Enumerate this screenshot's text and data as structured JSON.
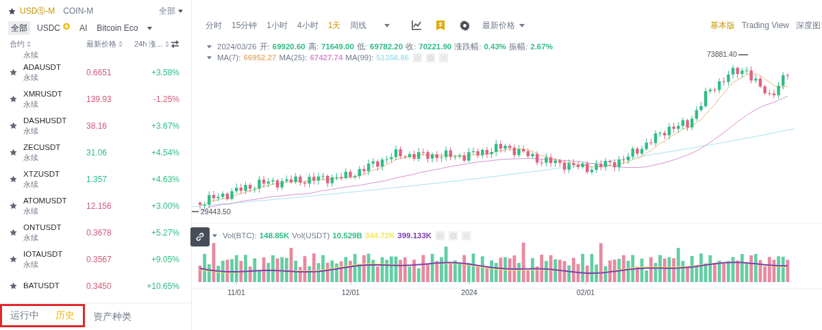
{
  "market_tabs": [
    {
      "label": "USDⓈ-M",
      "selected": true
    },
    {
      "label": "COIN-M",
      "selected": false
    }
  ],
  "filter_menu": "全部",
  "categories": [
    {
      "label": "全部",
      "selected": true,
      "kind": "text"
    },
    {
      "label": "USDC",
      "selected": false,
      "kind": "badge"
    },
    {
      "label": "AI",
      "selected": false,
      "kind": "text"
    },
    {
      "label": "Bitcoin Eco",
      "selected": false,
      "kind": "text"
    }
  ],
  "columns": [
    "合约",
    "最新价格",
    "24h 涨..."
  ],
  "partial_row": {
    "type": "永续"
  },
  "rows": [
    {
      "symbol": "ADAUSDT",
      "type": "永续",
      "price": "0.6651",
      "price_up": false,
      "change": "+3.58%",
      "change_up": true
    },
    {
      "symbol": "XMRUSDT",
      "type": "永续",
      "price": "139.93",
      "price_up": false,
      "change": "-1.25%",
      "change_up": false
    },
    {
      "symbol": "DASHUSDT",
      "type": "永续",
      "price": "38.16",
      "price_up": false,
      "change": "+3.67%",
      "change_up": true
    },
    {
      "symbol": "ZECUSDT",
      "type": "永续",
      "price": "31.06",
      "price_up": true,
      "change": "+4.54%",
      "change_up": true
    },
    {
      "symbol": "XTZUSDT",
      "type": "永续",
      "price": "1.357",
      "price_up": true,
      "change": "+4.63%",
      "change_up": true
    },
    {
      "symbol": "ATOMUSDT",
      "type": "永续",
      "price": "12.156",
      "price_up": false,
      "change": "+3.00%",
      "change_up": true
    },
    {
      "symbol": "ONTUSDT",
      "type": "永续",
      "price": "0.3678",
      "price_up": false,
      "change": "+5.27%",
      "change_up": true
    },
    {
      "symbol": "IOTAUSDT",
      "type": "永续",
      "price": "0.3567",
      "price_up": false,
      "change": "+9.05%",
      "change_up": true
    },
    {
      "symbol": "BATUSDT",
      "price": "0.3450",
      "price_up": false,
      "change": "+10.65%",
      "change_up": true
    }
  ],
  "bottom_tabs": [
    {
      "label": "运行中",
      "selected": false
    },
    {
      "label": "历史",
      "selected": true
    },
    {
      "label": "资产种类",
      "selected": false
    }
  ],
  "intervals": [
    {
      "label": "分时",
      "selected": false
    },
    {
      "label": "15分钟",
      "selected": false
    },
    {
      "label": "1小时",
      "selected": false
    },
    {
      "label": "4小时",
      "selected": false
    },
    {
      "label": "1天",
      "selected": true
    },
    {
      "label": "周线",
      "selected": false
    }
  ],
  "price_type": "最新价格",
  "view_modes": [
    {
      "label": "基本版",
      "selected": true
    },
    {
      "label": "Trading View",
      "selected": false
    },
    {
      "label": "深度图",
      "selected": false
    }
  ],
  "ohlc": {
    "date": "2024/03/26",
    "fields": [
      {
        "label": "开:",
        "value": "69920.60"
      },
      {
        "label": "高:",
        "value": "71649.00"
      },
      {
        "label": "低:",
        "value": "69782.20"
      },
      {
        "label": "收:",
        "value": "70221.90"
      },
      {
        "label": "涨跌幅:",
        "value": "0.43%"
      },
      {
        "label": "振幅:",
        "value": "2.67%"
      }
    ]
  },
  "ma": [
    {
      "label": "MA(7):",
      "value": "66952.27",
      "color": "#e8b57a"
    },
    {
      "label": "MA(25):",
      "value": "67427.74",
      "color": "#d98fd4"
    },
    {
      "label": "MA(99):",
      "value": "51358.86",
      "color": "#a8e4ee"
    }
  ],
  "volume": [
    {
      "label": "Vol(BTC):",
      "value": "148.85K",
      "color": "#2ebd85"
    },
    {
      "label": "Vol(USDT)",
      "value": "10.529B",
      "color": "#2ebd85"
    },
    {
      "value": "344.72K",
      "color": "#f5e663"
    },
    {
      "value": "399.133K",
      "color": "#7b3fb0"
    }
  ],
  "chart": {
    "high_label": "73881.40",
    "low_label": "29443.50",
    "x_labels": [
      "11/01",
      "12/01",
      "2024",
      "02/01"
    ]
  }
}
